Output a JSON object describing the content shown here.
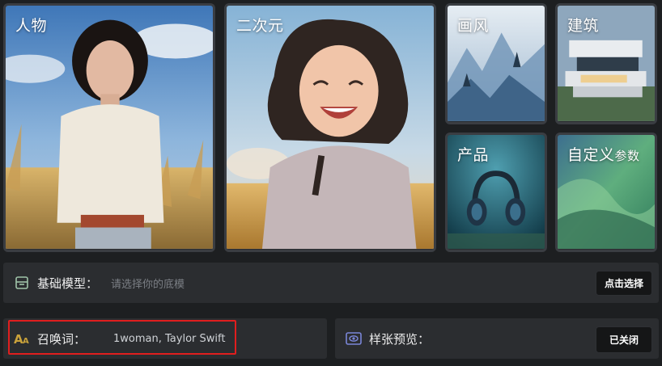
{
  "categories": [
    {
      "label": "人物"
    },
    {
      "label": "二次元"
    },
    {
      "label": "画风"
    },
    {
      "label": "建筑"
    },
    {
      "label": "产品"
    },
    {
      "label_main": "自定义",
      "label_small": "参数"
    }
  ],
  "base_model": {
    "title": "基础模型：",
    "placeholder": "请选择你的底模",
    "button": "点击选择"
  },
  "prompt": {
    "title": "召唤词：",
    "value": "1woman, Taylor Swift"
  },
  "sample_preview": {
    "title": "样张预览：",
    "button": "已关闭"
  },
  "colors": {
    "background": "#1d1f21",
    "panel": "#2b2d30",
    "highlight_border": "#e01e1e",
    "prompt_icon": "#c9a23b",
    "preview_icon": "#7a86d8"
  },
  "icons": {
    "model": "database-stack-icon",
    "prompt": "font-size-icon",
    "preview": "eye-icon"
  }
}
